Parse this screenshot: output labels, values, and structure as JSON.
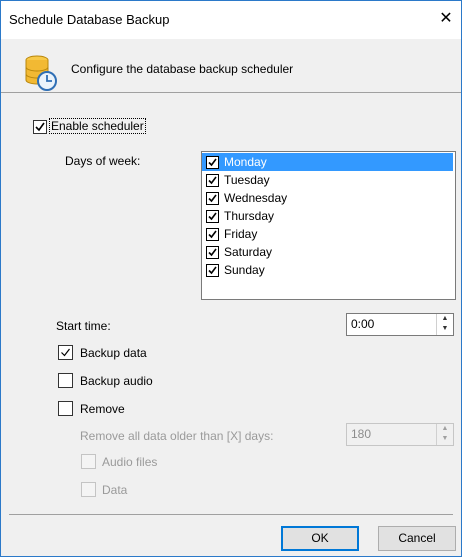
{
  "window": {
    "title": "Schedule Database Backup",
    "close_glyph": "✕"
  },
  "header": {
    "icon": "database-clock-icon",
    "text": "Configure the database backup scheduler"
  },
  "scheduler": {
    "enable_label": "Enable scheduler",
    "enabled": true
  },
  "days": {
    "label": "Days of week:",
    "items": [
      {
        "label": "Monday",
        "checked": true,
        "selected": true
      },
      {
        "label": "Tuesday",
        "checked": true,
        "selected": false
      },
      {
        "label": "Wednesday",
        "checked": true,
        "selected": false
      },
      {
        "label": "Thursday",
        "checked": true,
        "selected": false
      },
      {
        "label": "Friday",
        "checked": true,
        "selected": false
      },
      {
        "label": "Saturday",
        "checked": true,
        "selected": false
      },
      {
        "label": "Sunday",
        "checked": true,
        "selected": false
      }
    ]
  },
  "start_time": {
    "label": "Start time:",
    "value": "0:00"
  },
  "backup_data": {
    "label": "Backup data",
    "checked": true
  },
  "backup_audio": {
    "label": "Backup audio",
    "checked": false
  },
  "remove": {
    "label": "Remove",
    "checked": false,
    "older_than_label": "Remove all data older than [X] days:",
    "days_value": "180",
    "audio_files_label": "Audio files",
    "data_label": "Data"
  },
  "buttons": {
    "ok": "OK",
    "cancel": "Cancel"
  },
  "colors": {
    "selection": "#3399ff",
    "border_accent": "#2b79c9"
  }
}
